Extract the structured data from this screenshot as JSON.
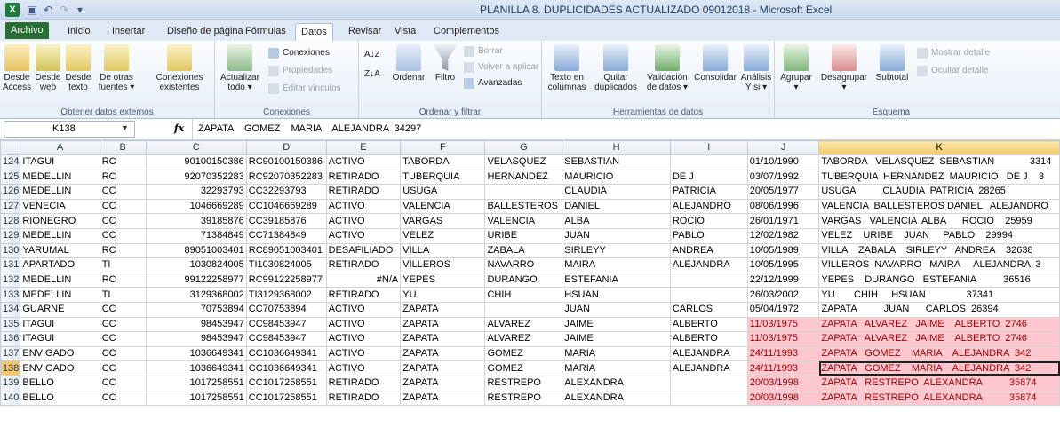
{
  "app": {
    "icon_letter": "X",
    "title": "PLANILLA 8. DUPLICIDADES ACTUALIZADO 09012018  -  Microsoft Excel"
  },
  "tabs": [
    "Archivo",
    "Inicio",
    "Insertar",
    "Diseño de página",
    "Fórmulas",
    "Datos",
    "Revisar",
    "Vista",
    "Complementos"
  ],
  "ribbon": {
    "external": {
      "label": "Obtener datos externos",
      "btns": [
        "Desde\nAccess",
        "Desde\nweb",
        "Desde\ntexto",
        "De otras\nfuentes ▾",
        "Conexiones\nexistentes"
      ]
    },
    "connections": {
      "label": "Conexiones",
      "refresh": "Actualizar\ntodo ▾",
      "items": [
        "Conexiones",
        "Propiedades",
        "Editar vínculos"
      ]
    },
    "sort": {
      "label": "Ordenar y filtrar",
      "sort_az": "A↓Z",
      "sort_za": "Z↓A",
      "ordenar": "Ordenar",
      "filtro": "Filtro",
      "items": [
        "Borrar",
        "Volver a aplicar",
        "Avanzadas"
      ]
    },
    "tools": {
      "label": "Herramientas de datos",
      "btns": [
        "Texto en\ncolumnas",
        "Quitar\nduplicados",
        "Validación\nde datos ▾",
        "Consolidar",
        "Análisis\nY si ▾"
      ]
    },
    "outline": {
      "label": "Esquema",
      "btns": [
        "Agrupar\n▾",
        "Desagrupar\n▾",
        "Subtotal"
      ],
      "items": [
        "Mostrar detalle",
        "Ocultar detalle"
      ]
    }
  },
  "formula": {
    "cell": "K138",
    "fx": "fx",
    "text": "ZAPATA    GOMEZ    MARIA    ALEJANDRA  34297"
  },
  "columns": [
    "A",
    "B",
    "C",
    "D",
    "E",
    "F",
    "G",
    "H",
    "I",
    "J",
    "K"
  ],
  "rows": [
    {
      "n": "124",
      "a": "ITAGUI",
      "b": "RC",
      "c": "90100150386",
      "d": "RC90100150386",
      "e": "ACTIVO",
      "f": "TABORDA",
      "g": "VELASQUEZ",
      "h": "SEBASTIAN",
      "i": "",
      "j": "01/10/1990",
      "k": "TABORDA   VELASQUEZ  SEBASTIAN             3314"
    },
    {
      "n": "125",
      "a": "MEDELLIN",
      "b": "RC",
      "c": "92070352283",
      "d": "RC92070352283",
      "e": "RETIRADO",
      "f": "TUBERQUIA",
      "g": "HERNANDEZ",
      "h": "MAURICIO",
      "i": "DE J",
      "j": "03/07/1992",
      "k": "TUBERQUIA  HERNANDEZ  MAURICIO   DE J    3"
    },
    {
      "n": "126",
      "a": "MEDELLIN",
      "b": "CC",
      "c": "32293793",
      "d": "CC32293793",
      "e": "RETIRADO",
      "f": "USUGA",
      "g": "",
      "h": "CLAUDIA",
      "i": "PATRICIA",
      "j": "20/05/1977",
      "k": "USUGA          CLAUDIA  PATRICIA  28265"
    },
    {
      "n": "127",
      "a": "VENECIA",
      "b": "CC",
      "c": "1046669289",
      "d": "CC1046669289",
      "e": "ACTIVO",
      "f": "VALENCIA",
      "g": "BALLESTEROS",
      "h": "DANIEL",
      "i": "ALEJANDRO",
      "j": "08/06/1996",
      "k": "VALENCIA  BALLESTEROS DANIEL   ALEJANDRO"
    },
    {
      "n": "128",
      "a": "RIONEGRO",
      "b": "CC",
      "c": "39185876",
      "d": "CC39185876",
      "e": "ACTIVO",
      "f": "VARGAS",
      "g": "VALENCIA",
      "h": "ALBA",
      "i": "ROCIO",
      "j": "26/01/1971",
      "k": "VARGAS   VALENCIA  ALBA      ROCIO    25959"
    },
    {
      "n": "129",
      "a": "MEDELLIN",
      "b": "CC",
      "c": "71384849",
      "d": "CC71384849",
      "e": "ACTIVO",
      "f": "VELEZ",
      "g": "URIBE",
      "h": "JUAN",
      "i": "PABLO",
      "j": "12/02/1982",
      "k": "VELEZ    URIBE    JUAN     PABLO    29994"
    },
    {
      "n": "130",
      "a": "YARUMAL",
      "b": "RC",
      "c": "89051003401",
      "d": "RC89051003401",
      "e": "DESAFILIADO",
      "f": "VILLA",
      "g": "ZABALA",
      "h": "SIRLEYY",
      "i": "ANDREA",
      "j": "10/05/1989",
      "k": "VILLA    ZABALA    SIRLEYY   ANDREA    32638"
    },
    {
      "n": "131",
      "a": "APARTADO",
      "b": "TI",
      "c": "1030824005",
      "d": "TI1030824005",
      "e": "RETIRADO",
      "f": "VILLEROS",
      "g": "NAVARRO",
      "h": "MAIRA",
      "i": "ALEJANDRA",
      "j": "10/05/1995",
      "k": "VILLEROS  NAVARRO   MAIRA     ALEJANDRA  3"
    },
    {
      "n": "132",
      "a": "MEDELLIN",
      "b": "RC",
      "c": "99122258977",
      "d": "RC99122258977",
      "e": "#N/A",
      "f": "YEPES",
      "g": "DURANGO",
      "h": "ESTEFANIA",
      "i": "",
      "j": "22/12/1999",
      "k": "YEPES    DURANGO   ESTEFANIA          36516"
    },
    {
      "n": "133",
      "a": "MEDELLIN",
      "b": "TI",
      "c": "3129368002",
      "d": "TI3129368002",
      "e": "RETIRADO",
      "f": "YU",
      "g": "CHIH",
      "h": "HSUAN",
      "i": "",
      "j": "26/03/2002",
      "k": "YU       CHIH     HSUAN               37341"
    },
    {
      "n": "134",
      "a": "GUARNE",
      "b": "CC",
      "c": "70753894",
      "d": "CC70753894",
      "e": "ACTIVO",
      "f": "ZAPATA",
      "g": "",
      "h": "JUAN",
      "i": "CARLOS",
      "j": "05/04/1972",
      "k": "ZAPATA          JUAN      CARLOS  26394"
    },
    {
      "n": "135",
      "a": "ITAGUI",
      "b": "CC",
      "c": "98453947",
      "d": "CC98453947",
      "e": "ACTIVO",
      "f": "ZAPATA",
      "g": "ALVAREZ",
      "h": "JAIME",
      "i": "ALBERTO",
      "j": "11/03/1975",
      "k": "ZAPATA   ALVAREZ   JAIME    ALBERTO  2746"
    },
    {
      "n": "136",
      "a": "ITAGUI",
      "b": "CC",
      "c": "98453947",
      "d": "CC98453947",
      "e": "ACTIVO",
      "f": "ZAPATA",
      "g": "ALVAREZ",
      "h": "JAIME",
      "i": "ALBERTO",
      "j": "11/03/1975",
      "k": "ZAPATA   ALVAREZ   JAIME    ALBERTO  2746"
    },
    {
      "n": "137",
      "a": "ENVIGADO",
      "b": "CC",
      "c": "1036649341",
      "d": "CC1036649341",
      "e": "ACTIVO",
      "f": "ZAPATA",
      "g": "GOMEZ",
      "h": "MARIA",
      "i": "ALEJANDRA",
      "j": "24/11/1993",
      "k": "ZAPATA   GOMEZ    MARIA    ALEJANDRA  342"
    },
    {
      "n": "138",
      "a": "ENVIGADO",
      "b": "CC",
      "c": "1036649341",
      "d": "CC1036649341",
      "e": "ACTIVO",
      "f": "ZAPATA",
      "g": "GOMEZ",
      "h": "MARIA",
      "i": "ALEJANDRA",
      "j": "24/11/1993",
      "k": "ZAPATA   GOMEZ    MARIA    ALEJANDRA  342"
    },
    {
      "n": "139",
      "a": "BELLO",
      "b": "CC",
      "c": "1017258551",
      "d": "CC1017258551",
      "e": "RETIRADO",
      "f": "ZAPATA",
      "g": "RESTREPO",
      "h": "ALEXANDRA",
      "i": "",
      "j": "20/03/1998",
      "k": "ZAPATA   RESTREPO  ALEXANDRA          35874"
    },
    {
      "n": "140",
      "a": "BELLO",
      "b": "CC",
      "c": "1017258551",
      "d": "CC1017258551",
      "e": "RETIRADO",
      "f": "ZAPATA",
      "g": "RESTREPO",
      "h": "ALEXANDRA",
      "i": "",
      "j": "20/03/1998",
      "k": "ZAPATA   RESTREPO  ALEXANDRA          35874"
    }
  ],
  "duplicate_rows": [
    "135",
    "136",
    "137",
    "138",
    "139",
    "140"
  ],
  "active_row": "138",
  "colors": {
    "dup_fill": "#ffc7ce",
    "dup_text": "#9c0006",
    "excel_green": "#2a6e36"
  }
}
